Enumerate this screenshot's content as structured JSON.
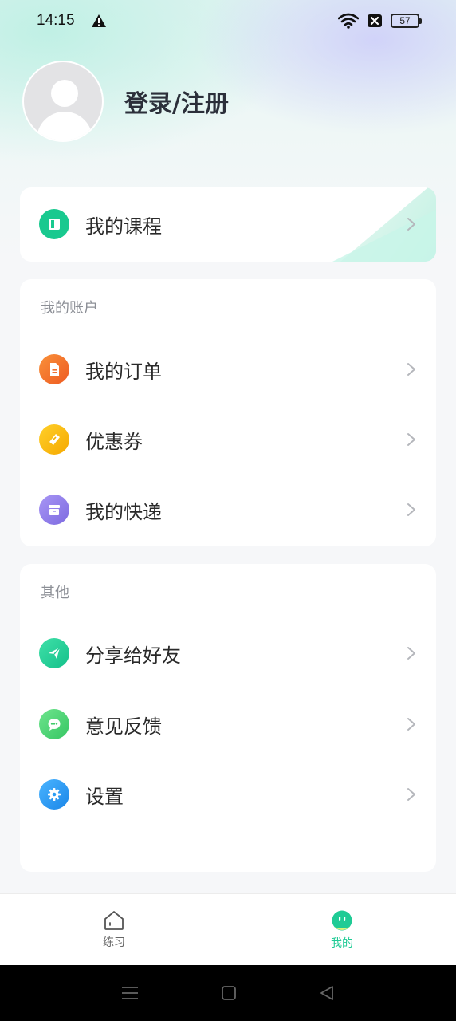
{
  "status_bar": {
    "time": "14:15",
    "battery": "57"
  },
  "profile": {
    "login_label": "登录/注册"
  },
  "course": {
    "label": "我的课程",
    "icon": "book-icon",
    "icon_color": "#19c98f"
  },
  "account_section": {
    "title": "我的账户",
    "items": [
      {
        "label": "我的订单",
        "icon": "order-document-icon",
        "color": "#f26b2a"
      },
      {
        "label": "优惠券",
        "icon": "coupon-ticket-icon",
        "color": "#f7b500"
      },
      {
        "label": "我的快递",
        "icon": "package-box-icon",
        "color": "#8a78e8"
      }
    ]
  },
  "other_section": {
    "title": "其他",
    "items": [
      {
        "label": "分享给好友",
        "icon": "paper-plane-icon",
        "color": "#1fcb95"
      },
      {
        "label": "意见反馈",
        "icon": "chat-bubble-icon",
        "color": "#4cd273"
      },
      {
        "label": "设置",
        "icon": "gear-icon",
        "color": "#2a9df4"
      }
    ]
  },
  "tabbar": {
    "tabs": [
      {
        "label": "练习",
        "icon": "house-icon",
        "active": false
      },
      {
        "label": "我的",
        "icon": "face-icon",
        "active": true
      }
    ],
    "active_color": "#1fcb95",
    "inactive_color": "#666666"
  }
}
